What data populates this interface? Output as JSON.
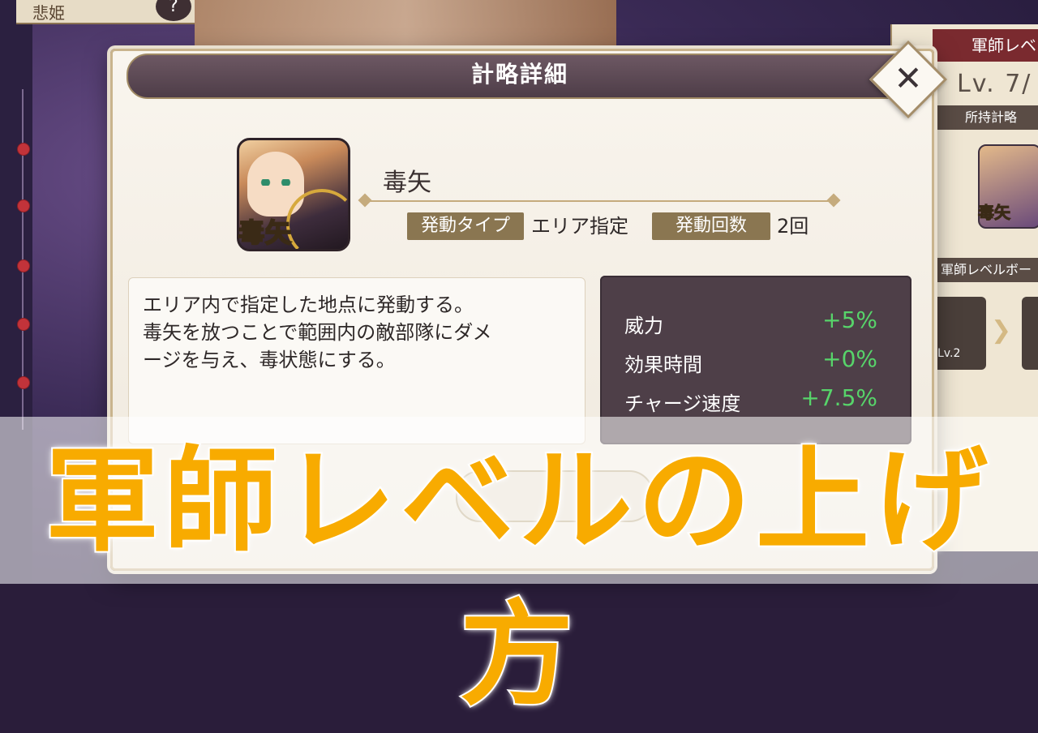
{
  "background": {
    "top_tab_label": "悲姫",
    "help_icon": "question-mark-icon"
  },
  "right_panel": {
    "header": "軍師レベ",
    "level": "Lv. 7/",
    "owned_header": "所持計略",
    "card_label": "毒矢",
    "bonus_header": "軍師レベルボー",
    "slot_level": "Lv.2"
  },
  "dialog": {
    "title": "計略詳細",
    "close_icon": "close-icon",
    "skill": {
      "icon_label": "毒矢",
      "name": "毒矢",
      "type_label": "発動タイプ",
      "type_value": "エリア指定",
      "count_label": "発動回数",
      "count_value": "2回"
    },
    "description": [
      "エリア内で指定した地点に発動する。",
      "毒矢を放つことで範囲内の敵部隊にダメ",
      "ージを与え、毒状態にする。"
    ],
    "stats": [
      {
        "label": "威力",
        "value": "+5%"
      },
      {
        "label": "効果時間",
        "value": "+0%"
      },
      {
        "label": "チャージ速度",
        "value": "+7.5%"
      }
    ]
  },
  "overlay_banner": "軍師レベルの上げ方",
  "colors": {
    "banner": "#f8ab00",
    "stat_positive": "#57d46a",
    "title_bar": "#5a4754",
    "tag_bg": "#8a7651"
  }
}
